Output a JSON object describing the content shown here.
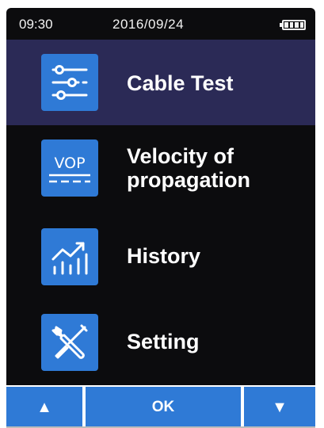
{
  "status_bar": {
    "time": "09:30",
    "date": "2016/09/24",
    "battery_icon": "battery-full-icon"
  },
  "menu": {
    "items": [
      {
        "label_line1": "Cable Test",
        "label_line2": "",
        "icon": "sliders-icon",
        "selected": true
      },
      {
        "label_line1": "Velocity of",
        "label_line2": "propagation",
        "icon": "vop-icon",
        "selected": false
      },
      {
        "label_line1": "History",
        "label_line2": "",
        "icon": "trend-chart-icon",
        "selected": false
      },
      {
        "label_line1": "Setting",
        "label_line2": "",
        "icon": "wrench-screwdriver-icon",
        "selected": false
      }
    ]
  },
  "vop_icon_text": "VOP",
  "buttons": {
    "up_label": "▲",
    "ok_label": "OK",
    "down_label": "▼"
  },
  "colors": {
    "accent": "#2f7ad6",
    "selected_bg": "#2b2a56",
    "screen_bg": "#0c0c0e"
  }
}
